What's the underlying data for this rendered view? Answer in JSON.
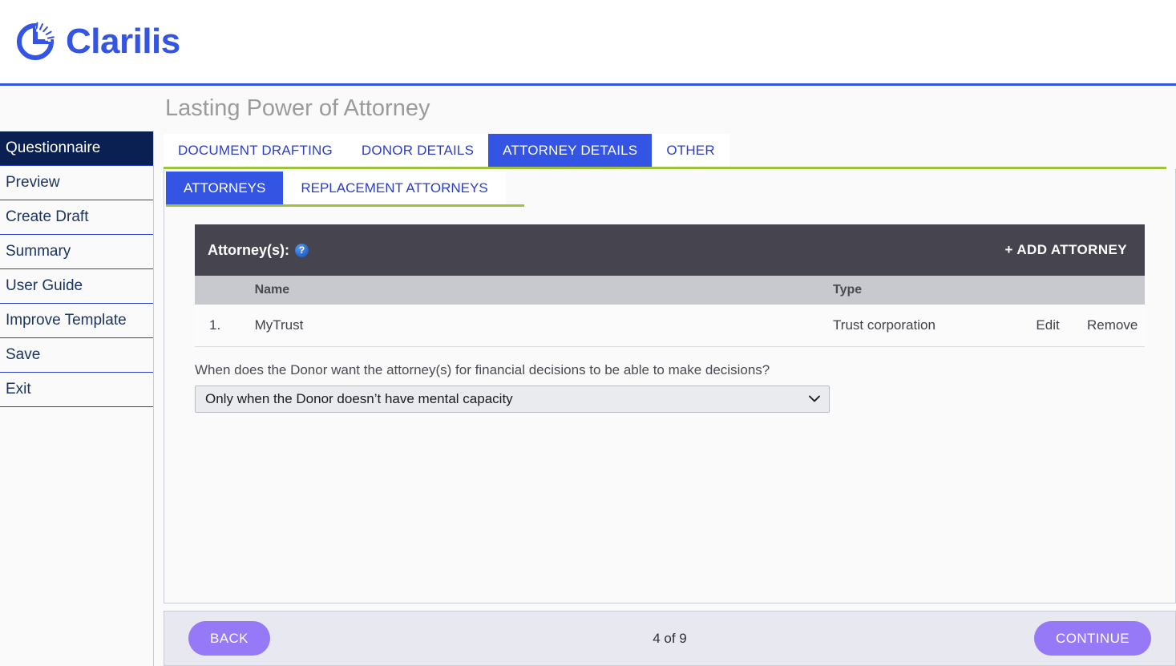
{
  "brand": {
    "name": "Clarilis",
    "logo_icon": "pie-chart-logo-icon",
    "accent_color": "#3454e3"
  },
  "header": {
    "page_title": "Lasting Power of Attorney"
  },
  "sidebar": {
    "items": [
      {
        "label": "Questionnaire",
        "active": true
      },
      {
        "label": "Preview",
        "active": false
      },
      {
        "label": "Create Draft",
        "active": false
      },
      {
        "label": "Summary",
        "active": false
      },
      {
        "label": "User Guide",
        "active": false
      },
      {
        "label": "Improve Template",
        "active": false
      },
      {
        "label": "Save",
        "active": false
      },
      {
        "label": "Exit",
        "active": false
      }
    ]
  },
  "tabs_outer": [
    {
      "label": "DOCUMENT DRAFTING",
      "active": false
    },
    {
      "label": "DONOR DETAILS",
      "active": false
    },
    {
      "label": "ATTORNEY DETAILS",
      "active": true
    },
    {
      "label": "OTHER",
      "active": false
    }
  ],
  "tabs_inner": [
    {
      "label": "ATTORNEYS",
      "active": true
    },
    {
      "label": "REPLACEMENT ATTORNEYS",
      "active": false
    }
  ],
  "attorney_card": {
    "heading": "Attorney(s):",
    "help_icon_label": "?",
    "add_button": "+ ADD ATTORNEY",
    "columns": {
      "number": "",
      "name": "Name",
      "type": "Type",
      "edit": "",
      "remove": ""
    },
    "rows": [
      {
        "number": "1.",
        "name": "MyTrust",
        "type": "Trust corporation",
        "edit": "Edit",
        "remove": "Remove"
      }
    ]
  },
  "question": {
    "text": "When does the Donor want the attorney(s) for financial decisions to be able to make decisions?",
    "selected_value": "Only when the Donor doesn’t have mental capacity",
    "chevron": "⌄"
  },
  "footer": {
    "back_label": "BACK",
    "page_indicator": "4 of 9",
    "continue_label": "CONTINUE"
  },
  "colors": {
    "brand_blue": "#3454e3",
    "sidebar_active": "#0a1f52",
    "tab_green": "#9dc33e",
    "card_header_dark": "#45444f",
    "button_purple": "#9579f6"
  }
}
